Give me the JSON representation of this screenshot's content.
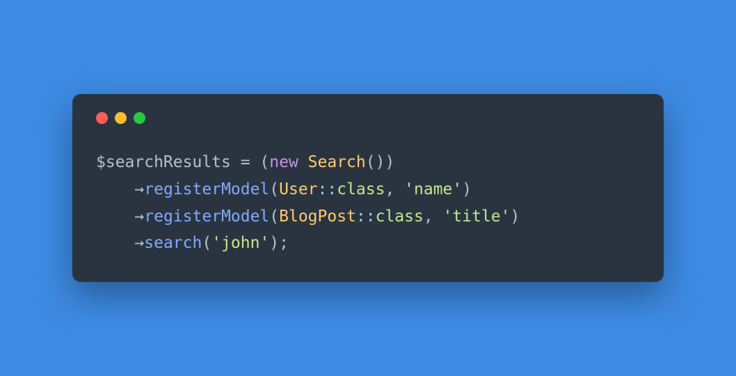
{
  "code": {
    "line1": {
      "var": "$searchResults",
      "eq": " = (",
      "kw": "new",
      "sp": " ",
      "class": "Search",
      "tail": "())"
    },
    "line2": {
      "indent": "    ",
      "arrow": "→",
      "method": "registerModel",
      "open": "(",
      "class": "User",
      "dcolon": "::",
      "prop": "class",
      "comma": ", ",
      "str": "'name'",
      "close": ")"
    },
    "line3": {
      "indent": "    ",
      "arrow": "→",
      "method": "registerModel",
      "open": "(",
      "class": "BlogPost",
      "dcolon": "::",
      "prop": "class",
      "comma": ", ",
      "str": "'title'",
      "close": ")"
    },
    "line4": {
      "indent": "    ",
      "arrow": "→",
      "method": "search",
      "open": "(",
      "str": "'john'",
      "close": ");"
    }
  }
}
